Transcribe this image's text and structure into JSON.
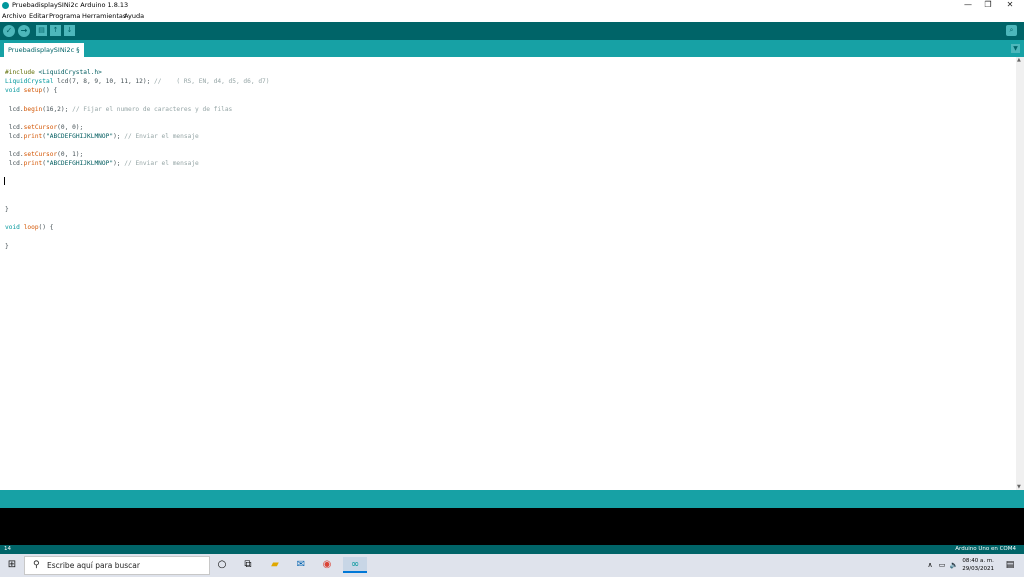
{
  "window": {
    "title": "PruebadisplaySINi2c Arduino 1.8.13",
    "controls": {
      "minimize": "—",
      "restore": "❐",
      "close": "✕"
    }
  },
  "menu": [
    "Archivo",
    "Editar",
    "Programa",
    "Herramientas",
    "Ayuda"
  ],
  "toolbar": {
    "verify_icon": "check-icon",
    "upload_icon": "arrow-right-icon",
    "new_icon": "new-file-icon",
    "open_icon": "open-icon",
    "save_icon": "save-icon",
    "serial_monitor_icon": "magnifier-icon"
  },
  "tab": {
    "label": "PruebadisplaySINi2c §"
  },
  "code_lines": [
    "#include <LiquidCrystal.h>",
    "LiquidCrystal lcd(7, 8, 9, 10, 11, 12); //    ( RS, EN, d4, d5, d6, d7)",
    "void setup() {",
    "",
    " lcd.begin(16,2); // Fijar el numero de caracteres y de filas",
    "",
    " lcd.setCursor(0, 0);",
    " lcd.print(\"ABCDEFGHIJKLMNOP\"); // Enviar el mensaje",
    "",
    " lcd.setCursor(0, 1);",
    " lcd.print(\"ABCDEFGHIJKLMNOP\"); // Enviar el mensaje",
    "",
    "",
    "",
    "",
    "}",
    "",
    "void loop() {",
    "",
    "}"
  ],
  "status": {
    "line": "14",
    "board": "Arduino Uno en COM4"
  },
  "taskbar": {
    "search_placeholder": "Escribe aquí para buscar",
    "time": "08:40 a. m.",
    "date": "29/03/2021"
  },
  "colors": {
    "toolbar": "#006468",
    "tabbar": "#17a1a5",
    "keyword": "#00979c",
    "function": "#d35400",
    "comment": "#95a5a6"
  }
}
